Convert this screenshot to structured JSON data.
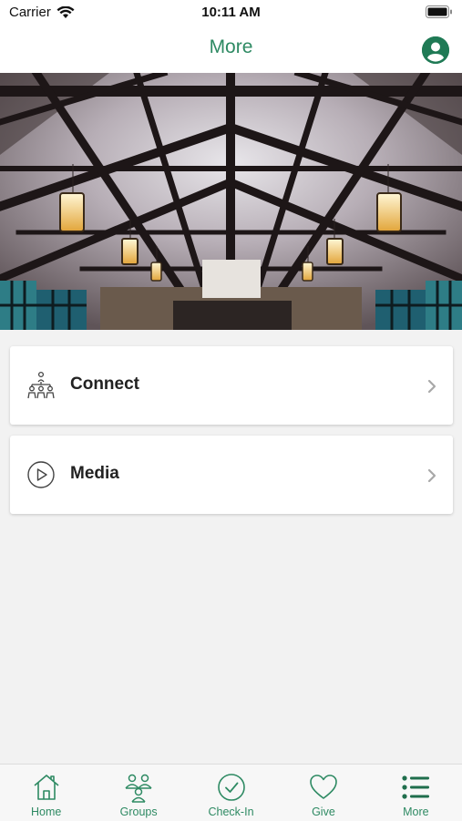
{
  "status_bar": {
    "carrier": "Carrier",
    "time": "10:11 AM"
  },
  "header": {
    "title": "More",
    "profile_icon": "person-circle-icon"
  },
  "hero_image": {
    "description_icon": "church-ceiling-photo"
  },
  "menu": [
    {
      "label": "Connect",
      "icon": "people-network-icon"
    },
    {
      "label": "Media",
      "icon": "play-circle-icon"
    }
  ],
  "tab_bar": {
    "items": [
      {
        "label": "Home",
        "icon": "home-icon"
      },
      {
        "label": "Groups",
        "icon": "groups-icon"
      },
      {
        "label": "Check-In",
        "icon": "check-circle-icon"
      },
      {
        "label": "Give",
        "icon": "heart-icon"
      },
      {
        "label": "More",
        "icon": "list-icon"
      }
    ]
  },
  "colors": {
    "accent": "#2e8a63",
    "profile": "#1f7a55",
    "background": "#f2f2f2"
  }
}
